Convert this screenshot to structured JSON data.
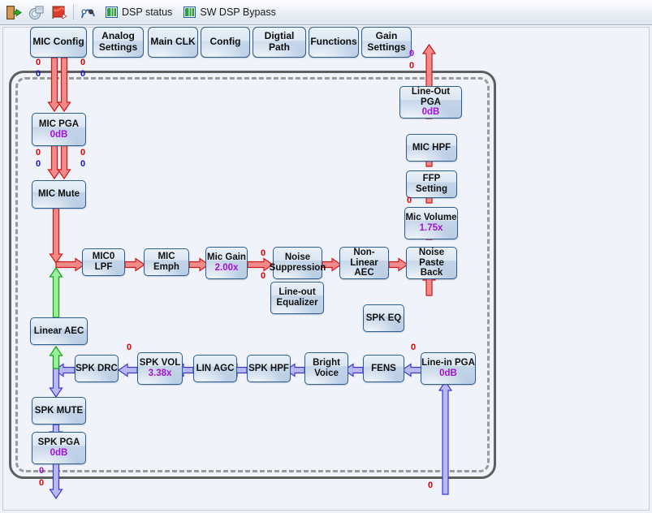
{
  "toolbar": {
    "buttons": [
      {
        "name": "exit-icon",
        "label": "Exit"
      },
      {
        "name": "read-device-icon",
        "label": "Read"
      },
      {
        "name": "write-device-icon",
        "label": "Write"
      },
      {
        "name": "curve-tool-icon",
        "label": "Curve"
      }
    ],
    "items": [
      {
        "name": "dsp-status",
        "label": "DSP status",
        "icon": "grid-icon"
      },
      {
        "name": "sw-dsp-bypass",
        "label": "SW DSP Bypass",
        "icon": "grid-icon"
      }
    ]
  },
  "tabs": [
    {
      "label": "MIC Config"
    },
    {
      "label": "Analog\nSettings"
    },
    {
      "label": "Main CLK"
    },
    {
      "label": "Config"
    },
    {
      "label": "Digtial Path"
    },
    {
      "label": "Functions"
    },
    {
      "label": "Gain\nSettings"
    }
  ],
  "blocks": {
    "mic_pga": {
      "title": "MIC PGA",
      "value": "0dB"
    },
    "mic_mute": {
      "title": "MIC Mute",
      "value": ""
    },
    "linear_aec": {
      "title": "Linear AEC",
      "value": ""
    },
    "spk_mute": {
      "title": "SPK MUTE",
      "value": ""
    },
    "spk_pga": {
      "title": "SPK PGA",
      "value": "0dB"
    },
    "mic0_lpf": {
      "title": "MIC0 LPF",
      "value": ""
    },
    "mic_emph": {
      "title": "MIC Emph",
      "value": ""
    },
    "mic_gain": {
      "title": "Mic Gain",
      "value": "2.00x"
    },
    "noise_suppression": {
      "title": "Noise\nSuppression",
      "value": ""
    },
    "line_out_eq": {
      "title": "Line-out\nEqualizer",
      "value": ""
    },
    "non_linear_aec": {
      "title": "Non-Linear\nAEC",
      "value": ""
    },
    "noise_paste_back": {
      "title": "Noise Paste\nBack",
      "value": ""
    },
    "mic_volume": {
      "title": "Mic Volume",
      "value": "1.75x"
    },
    "ffp_setting": {
      "title": "FFP Setting",
      "value": ""
    },
    "mic_hpf": {
      "title": "MIC HPF",
      "value": ""
    },
    "line_out_pga": {
      "title": "Line-Out PGA",
      "value": "0dB"
    },
    "spk_drc": {
      "title": "SPK DRC",
      "value": ""
    },
    "spk_vol": {
      "title": "SPK VOL",
      "value": "3.38x"
    },
    "lin_agc": {
      "title": "LIN AGC",
      "value": ""
    },
    "spk_hpf": {
      "title": "SPK HPF",
      "value": ""
    },
    "bright_voice": {
      "title": "Bright\nVoice",
      "value": ""
    },
    "fens": {
      "title": "FENS",
      "value": ""
    },
    "spk_eq": {
      "title": "SPK EQ",
      "value": ""
    },
    "line_in_pga": {
      "title": "Line-in PGA",
      "value": "0dB"
    }
  },
  "signal_labels": {
    "mic_top_left_red": "0",
    "mic_top_left_blue": "0",
    "mic_top_right_red": "0",
    "mic_top_right_blue": "0",
    "mic_pga_out_left_red": "0",
    "mic_pga_out_left_blue": "0",
    "mic_pga_out_right_red": "0",
    "mic_pga_out_right_blue": "0",
    "mic_gain_out_top": "0",
    "mic_gain_out_bottom": "0",
    "mic_volume_in": "0",
    "line_out_pga_top_purple": "0",
    "line_out_pga_top_red": "0",
    "spk_vol_in": "0",
    "line_in_pga_in": "0",
    "spk_pga_out_purple": "0",
    "spk_pga_out_red": "0",
    "line_in_bottom_red": "0"
  },
  "colors": {
    "mic_path": "#e83030",
    "spk_path": "#4a4ae0",
    "aec_path": "#2fd02f",
    "value_text": "#a610d8",
    "frame_outer": "#5e5e5e",
    "frame_inner": "#9a9a9a",
    "canvas_bg": "#f0f3f9"
  }
}
